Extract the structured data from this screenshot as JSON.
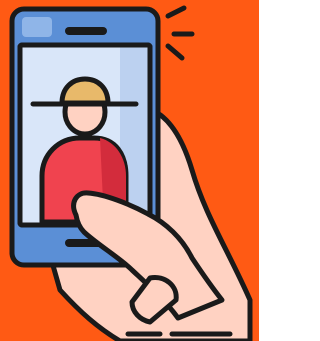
{
  "illustration": {
    "icon": "hand-holding-smartphone-video-call-icon",
    "colors": {
      "background": "#FF5A14",
      "outline": "#1A1A1A",
      "phone_body": "#5B8FD6",
      "phone_body_dark": "#3F72BD",
      "phone_body_light": "#8FB5E8",
      "screen": "#D9E6F9",
      "screen_shade": "#BCD1F0",
      "skin": "#FFD2C2",
      "skin_shade": "#F2B4A0",
      "hat": "#E8B96A",
      "shirt": "#F0434F",
      "shirt_shade": "#D32C3C",
      "notch": "#1A1A1A"
    }
  }
}
